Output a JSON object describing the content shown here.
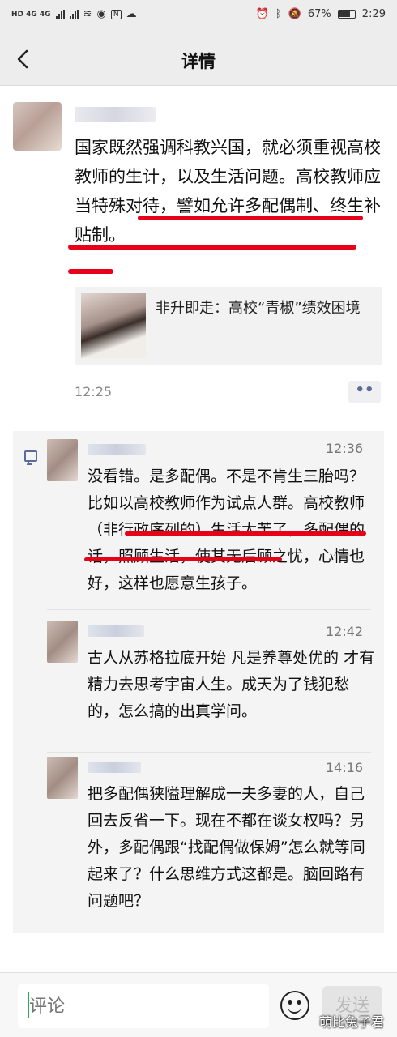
{
  "status_bar": {
    "network_left": "HD 4G 4G",
    "battery": "67%",
    "time": "2:29"
  },
  "header": {
    "back_icon": "back-chevron-icon",
    "title": "详情"
  },
  "post": {
    "text": "国家既然强调科教兴国，就必须重视高校教师的生计，以及生活问题。高校教师应当特殊对待，譬如允许多配偶制、终生补贴制。",
    "link": {
      "title": "非升即走：高校“青椒”绩效困境"
    },
    "time": "12:25",
    "more_label": "••"
  },
  "comments": [
    {
      "time": "12:36",
      "text": "没看错。是多配偶。不是不肯生三胎吗？比如以高校教师作为试点人群。高校教师（非行政序列的）生活太苦了，多配偶的话，照顾生活，使其无后顾之忧，心情也好，这样也愿意生孩子。"
    },
    {
      "time": "12:42",
      "text": "古人从苏格拉底开始 凡是养尊处优的 才有精力去思考宇宙人生。成天为了钱犯愁的，怎么搞的出真学问。"
    },
    {
      "time": "14:16",
      "text": "把多配偶狭隘理解成一夫多妻的人，自己回去反省一下。现在不都在谈女权吗？另外，多配偶跟“找配偶做保姆”怎么就等同起来了？什么思维方式这都是。脑回路有问题吧？"
    }
  ],
  "input_bar": {
    "placeholder": "评论",
    "send_label": "发送",
    "emoji_icon": "emoji-icon"
  },
  "watermark": "萌比兔子君",
  "colors": {
    "accent_red": "#e8001a",
    "link_blue": "#5a6d96",
    "bg_gray": "#ededed"
  }
}
